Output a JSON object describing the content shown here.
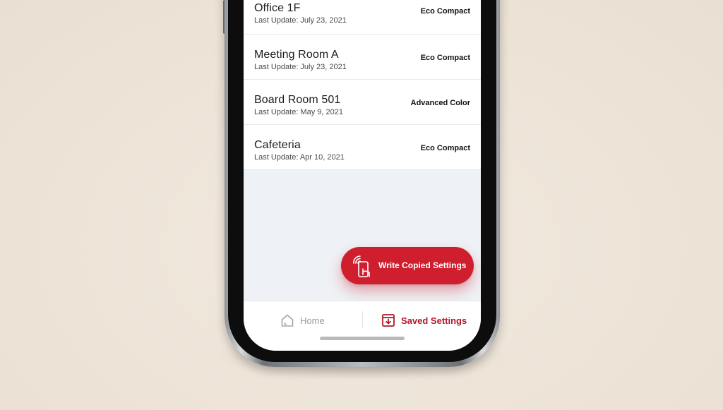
{
  "locations": [
    {
      "name": "Office 1F",
      "updated": "Last Update: July 23, 2021",
      "model": "Eco Compact"
    },
    {
      "name": "Meeting Room A",
      "updated": "Last Update: July 23, 2021",
      "model": "Eco Compact"
    },
    {
      "name": "Board Room 501",
      "updated": "Last Update: May 9, 2021",
      "model": "Advanced Color"
    },
    {
      "name": "Cafeteria",
      "updated": "Last Update: Apr 10, 2021",
      "model": "Eco  Compact"
    }
  ],
  "fab": {
    "label": "Write Copied Settings",
    "icon": "nfc-phone-icon"
  },
  "tabs": {
    "home": {
      "label": "Home",
      "icon": "home-icon"
    },
    "saved": {
      "label": "Saved Settings",
      "icon": "download-box-icon"
    }
  },
  "colors": {
    "accent": "#cf1f2e",
    "accent_text": "#b3182a",
    "background": "#eef1f5",
    "inactive": "#9a9ca0"
  }
}
